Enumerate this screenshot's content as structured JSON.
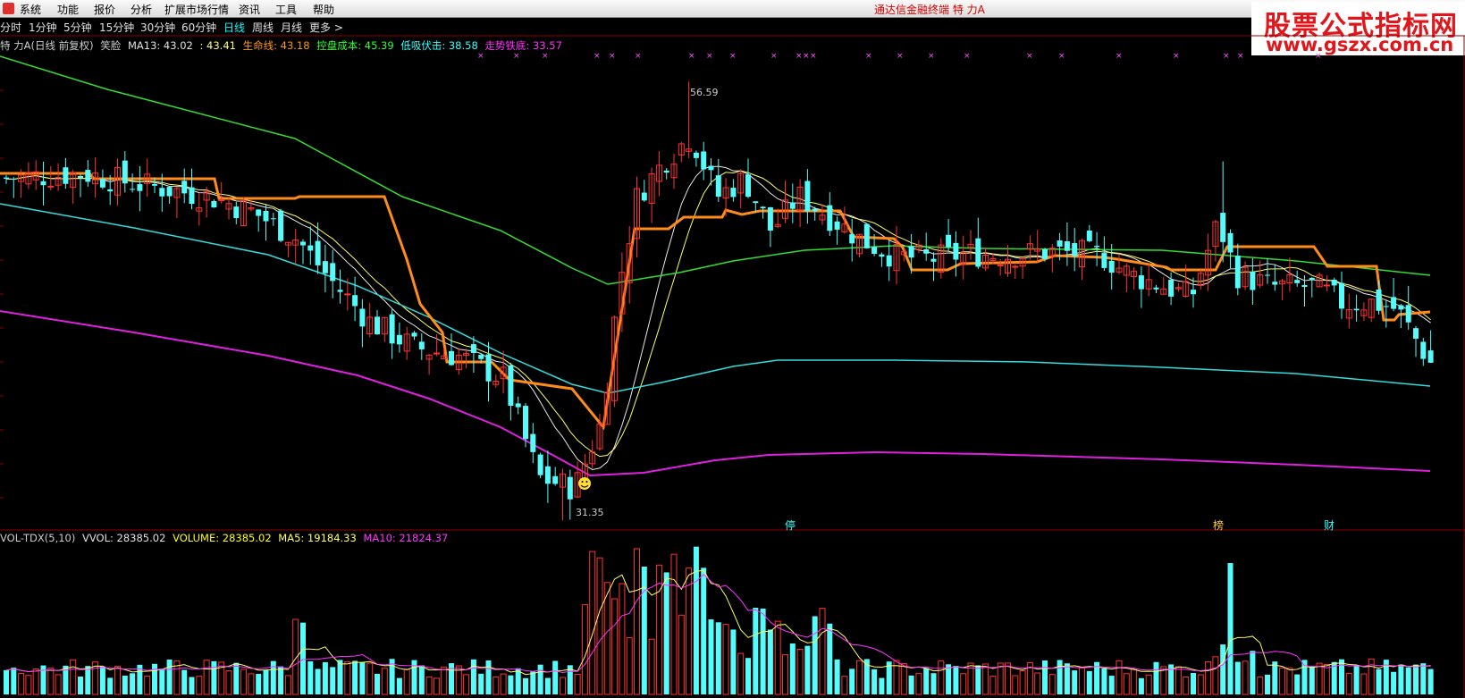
{
  "menu": {
    "items": [
      "系统",
      "功能",
      "报价",
      "分析",
      "扩展市场行情",
      "资讯",
      "工具",
      "帮助"
    ],
    "title": "通达信金融终端   特 力A"
  },
  "periods": {
    "items": [
      "分时",
      "1分钟",
      "5分钟",
      "15分钟",
      "30分钟",
      "60分钟",
      "日线",
      "周线",
      "月线",
      "更多 >"
    ],
    "active": "日线"
  },
  "watermark": {
    "line1": "股票公式指标网",
    "line2": "www.gszx.com.cn"
  },
  "legend": [
    {
      "text": "特 力A(日线 前复权)",
      "color": "#cccccc"
    },
    {
      "text": "笑脸",
      "color": "#cccccc"
    },
    {
      "text": "MA13: 43.02",
      "color": "#e0e0e0"
    },
    {
      "text": ": 43.41",
      "color": "#ffff66"
    },
    {
      "text": "生命线: 43.18",
      "color": "#ff9900"
    },
    {
      "text": "控盘成本: 45.39",
      "color": "#33ff33"
    },
    {
      "text": "低吸伏击: 38.58",
      "color": "#33ffff"
    },
    {
      "text": "走势铁底: 33.57",
      "color": "#ff33ff"
    }
  ],
  "vol_legend": [
    {
      "text": "VOL-TDX(5,10)",
      "color": "#cccccc"
    },
    {
      "text": "VVOL: 28385.02",
      "color": "#e0e0e0"
    },
    {
      "text": "VOLUME: 28385.02",
      "color": "#ffff00"
    },
    {
      "text": "MA5: 19184.33",
      "color": "#ffff66"
    },
    {
      "text": "MA10: 21824.37",
      "color": "#ff33ff"
    }
  ],
  "annotations": {
    "high": "56.59",
    "low": "31.35",
    "marks": [
      "停",
      "榜",
      "财"
    ]
  },
  "colors": {
    "up": "#ff3232",
    "down": "#54fcfc",
    "life": "#ff8c1a",
    "control": "#33dd33",
    "ambush": "#33dddd",
    "bottom": "#e020e0"
  },
  "chart_data": {
    "type": "candlestick",
    "price_range": [
      28,
      61
    ],
    "key_prices": {
      "high": 56.59,
      "low": 31.35
    },
    "last": {
      "MA13": 43.02,
      "MA_alt": 43.41,
      "life_line": 43.18,
      "control_cost": 45.39,
      "ambush": 38.58,
      "iron_bottom": 33.57
    },
    "volume_last": {
      "VVOL": 28385.02,
      "VOLUME": 28385.02,
      "MA5": 19184.33,
      "MA10": 21824.37
    }
  }
}
